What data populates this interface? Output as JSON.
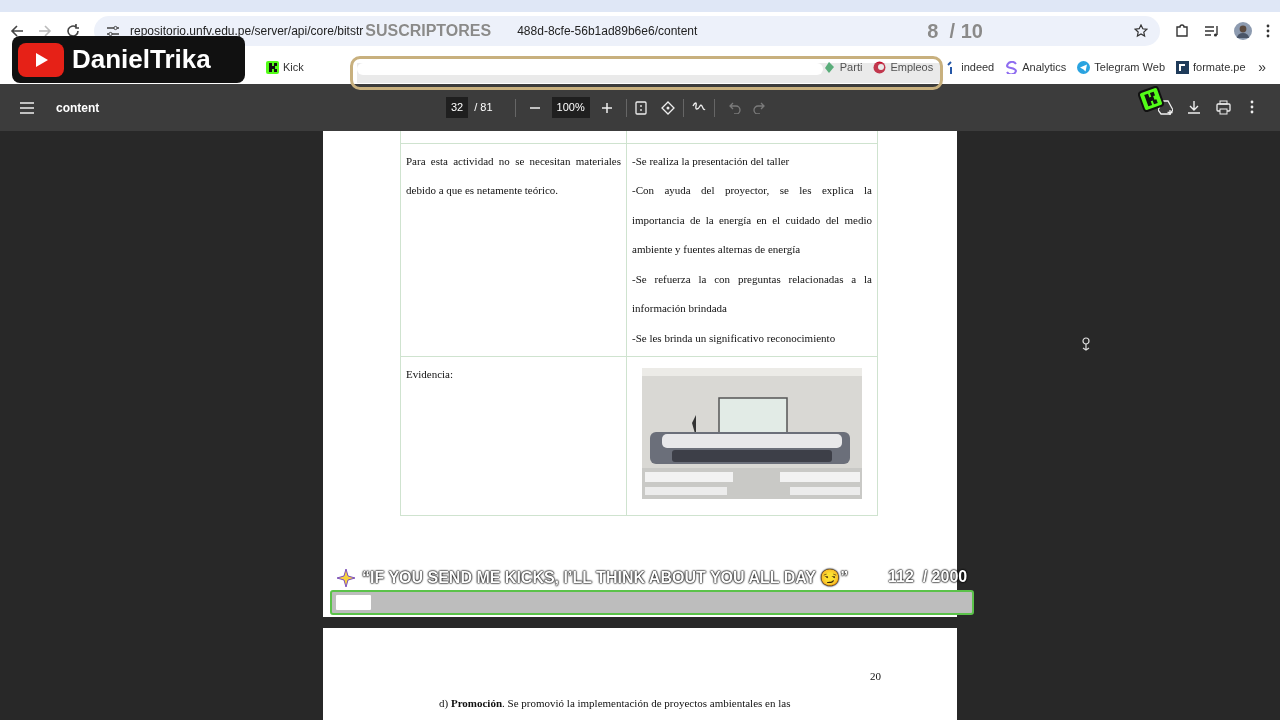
{
  "browser": {
    "url_start": "repositorio.unfv.edu.pe/server/api/core/bitstr",
    "url_end": "488d-8cfe-56b1ad89b6e6/content",
    "bookmarks": [
      {
        "label": "Kick",
        "kind": "kick"
      },
      {
        "label": "Parti",
        "kind": "parti"
      },
      {
        "label": "Empleos",
        "kind": "empleos"
      },
      {
        "label": "indeed",
        "kind": "indeed"
      },
      {
        "label": "Analytics",
        "kind": "analytics"
      },
      {
        "label": "Telegram Web",
        "kind": "telegram"
      },
      {
        "label": "formate.pe",
        "kind": "formate"
      }
    ],
    "more_bookmarks": "»"
  },
  "pdf_toolbar": {
    "title": "content",
    "page": "32",
    "page_total": "/ 81",
    "zoom": "100%",
    "undo_disabled": true,
    "redo_disabled": true
  },
  "document": {
    "table": [
      {
        "left": "Para esta actividad no se necesitan materiales debido a que es netamente teórico.",
        "right": [
          "-Se realiza la presentación del taller",
          "-Con ayuda del proyector, se les explica la importancia de la energía en el cuidado del medio ambiente y fuentes alternas de energía",
          "-Se refuerza la con preguntas relacionadas a la información brindada",
          "-Se les brinda un significativo reconocimiento"
        ]
      },
      {
        "left": "Evidencia:"
      }
    ],
    "page_number": "20",
    "next_text": "d) **Promoción**. Se promovió la implementación de proyectos ambientales en las"
  },
  "stream_overlay": {
    "channel": "DanielTrika",
    "subscribers": {
      "label": "SUSCRIPTORES",
      "count": "8  / 10",
      "level": 0.8
    },
    "kicks": {
      "label": "“IF YOU SEND ME KICKS, I’LL THINK ABOUT YOU ALL DAY 😏”",
      "count": "112  / 2000",
      "level": 0.056
    }
  }
}
